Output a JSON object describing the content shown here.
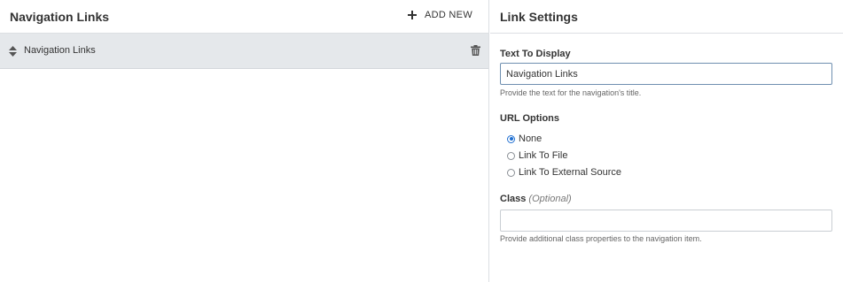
{
  "left_panel": {
    "title": "Navigation Links",
    "add_new_label": "ADD NEW",
    "items": [
      {
        "label": "Navigation Links"
      }
    ]
  },
  "settings": {
    "title": "Link Settings",
    "text_to_display": {
      "label": "Text To Display",
      "value": "Navigation Links",
      "help": "Provide the text for the navigation's title."
    },
    "url_options": {
      "label": "URL Options",
      "options": [
        {
          "label": "None",
          "checked": true
        },
        {
          "label": "Link To File",
          "checked": false
        },
        {
          "label": "Link To External Source",
          "checked": false
        }
      ]
    },
    "class_field": {
      "label": "Class",
      "optional_label": "(Optional)",
      "value": "",
      "help": "Provide additional class properties to the navigation item."
    }
  },
  "icons": {
    "add": "plus-icon",
    "sort": "sort-icon",
    "delete": "trash-icon"
  },
  "colors": {
    "selected_row_bg": "#e5e8eb",
    "radio_accent": "#1f6fd1",
    "border": "#dcdfe3"
  }
}
